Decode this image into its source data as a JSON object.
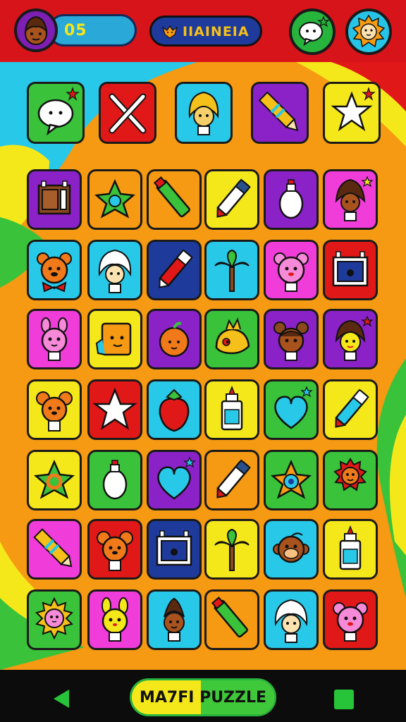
{
  "top_bar": {
    "score_value": "05",
    "title": "IIAINEIA",
    "icons": [
      "player-avatar-icon",
      "fox-icon",
      "chat-bubble-icon",
      "lion-icon"
    ]
  },
  "powerups": [
    {
      "icon": "speech-bubble-icon",
      "bg": "#39c23a"
    },
    {
      "icon": "crossed-tools-icon",
      "bg": "#e01818"
    },
    {
      "icon": "blonde-girl-icon",
      "bg": "#28c8e8"
    },
    {
      "icon": "pencil-icon",
      "bg": "#8a22c8"
    },
    {
      "icon": "star-icon",
      "bg": "#f5e81a"
    }
  ],
  "grid": [
    [
      {
        "icon": "window-icon",
        "bg": "#8a22c8"
      },
      {
        "icon": "green-star-icon",
        "bg": "#f59a12"
      },
      {
        "icon": "green-marker-icon",
        "bg": "#f59a12"
      },
      {
        "icon": "white-marker-icon",
        "bg": "#f5e81a"
      },
      {
        "icon": "lightbulb-icon",
        "bg": "#8a22c8"
      },
      {
        "icon": "witch-girl-icon",
        "bg": "#f03cd8"
      }
    ],
    [
      {
        "icon": "bear-icon",
        "bg": "#28c8e8"
      },
      {
        "icon": "white-hair-girl-icon",
        "bg": "#28c8e8"
      },
      {
        "icon": "red-marker-icon",
        "bg": "#1e3a9a"
      },
      {
        "icon": "palm-tree-icon",
        "bg": "#28c8e8"
      },
      {
        "icon": "pink-bear-icon",
        "bg": "#f03cd8"
      },
      {
        "icon": "tv-icon",
        "bg": "#e01818"
      }
    ],
    [
      {
        "icon": "pink-bunny-icon",
        "bg": "#f03cd8"
      },
      {
        "icon": "box-creature-icon",
        "bg": "#f5e81a"
      },
      {
        "icon": "orange-fruit-icon",
        "bg": "#8a22c8"
      },
      {
        "icon": "yellow-bird-icon",
        "bg": "#39c23a"
      },
      {
        "icon": "brown-bear-girl-icon",
        "bg": "#8a22c8"
      },
      {
        "icon": "star-girl-icon",
        "bg": "#8a22c8"
      }
    ],
    [
      {
        "icon": "mouse-icon",
        "bg": "#f5e81a"
      },
      {
        "icon": "white-star-icon",
        "bg": "#e01818"
      },
      {
        "icon": "strawberry-icon",
        "bg": "#28c8e8"
      },
      {
        "icon": "glue-bottle-icon",
        "bg": "#f5e81a"
      },
      {
        "icon": "heart-icon",
        "bg": "#39c23a"
      },
      {
        "icon": "blue-marker-icon",
        "bg": "#f5e81a"
      }
    ],
    [
      {
        "icon": "ring-star-icon",
        "bg": "#f5e81a"
      },
      {
        "icon": "lightbulb-icon",
        "bg": "#39c23a"
      },
      {
        "icon": "heart-icon",
        "bg": "#8a22c8"
      },
      {
        "icon": "white-marker-icon",
        "bg": "#f59a12"
      },
      {
        "icon": "blue-ring-star-icon",
        "bg": "#39c23a"
      },
      {
        "icon": "lion-icon",
        "bg": "#39c23a"
      }
    ],
    [
      {
        "icon": "pencil-icon",
        "bg": "#f03cd8"
      },
      {
        "icon": "mouse-icon",
        "bg": "#e01818"
      },
      {
        "icon": "tv-icon",
        "bg": "#1e3a9a"
      },
      {
        "icon": "palm-tree-icon",
        "bg": "#f5e81a"
      },
      {
        "icon": "monkey-icon",
        "bg": "#28c8e8"
      },
      {
        "icon": "glue-bottle-icon",
        "bg": "#f5e81a"
      }
    ],
    [
      {
        "icon": "sun-cat-icon",
        "bg": "#39c23a"
      },
      {
        "icon": "yellow-bunny-icon",
        "bg": "#f03cd8"
      },
      {
        "icon": "brown-girl-icon",
        "bg": "#28c8e8"
      },
      {
        "icon": "green-marker-icon",
        "bg": "#f59a12"
      },
      {
        "icon": "white-hair-girl-icon",
        "bg": "#28c8e8"
      },
      {
        "icon": "pink-bear-icon",
        "bg": "#e01818"
      }
    ]
  ],
  "bottom_bar": {
    "home_label": "MA7FI PUZZLE",
    "icons": [
      "back-triangle-icon",
      "recent-square-icon"
    ]
  }
}
